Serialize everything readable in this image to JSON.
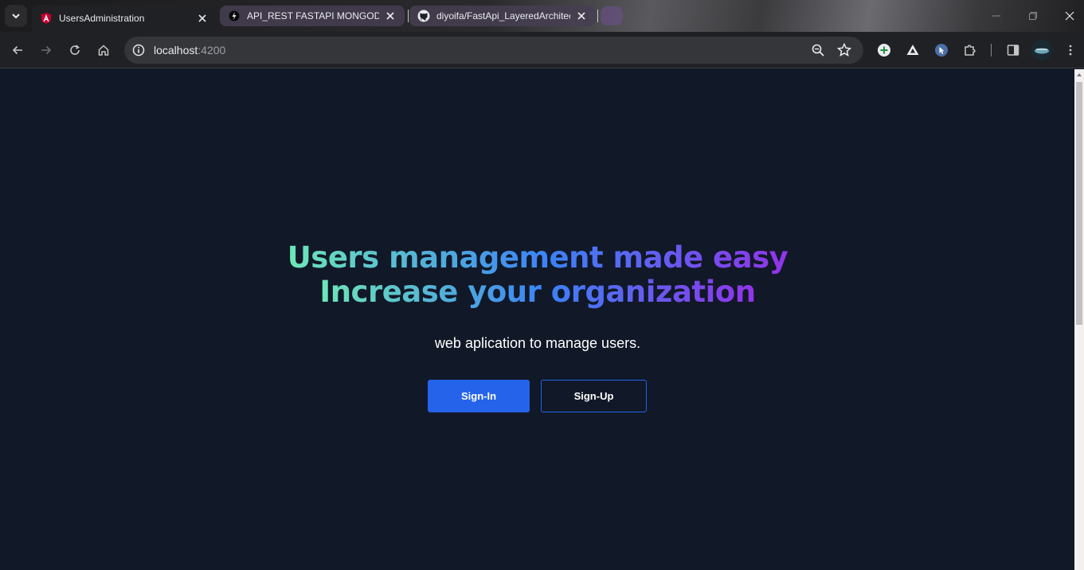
{
  "browser": {
    "tabs": [
      {
        "label": "UsersAdministration",
        "icon": "angular-icon",
        "active": true
      },
      {
        "label": "API_REST FASTAPI MONGODB J",
        "icon": "fastapi-icon",
        "active": false
      },
      {
        "label": "diyoifa/FastApi_LayeredArchitec",
        "icon": "github-icon",
        "active": false
      }
    ],
    "url_host": "localhost",
    "url_port": ":4200"
  },
  "hero": {
    "line1": "Users management made easy",
    "line2": "Increase your organization",
    "subtitle": "web aplication to manage users."
  },
  "actions": {
    "signin_label": "Sign-In",
    "signup_label": "Sign-Up"
  },
  "colors": {
    "page_bg": "#111827",
    "primary": "#2563eb",
    "gradient_start": "#6ee7b7",
    "gradient_mid": "#3b82f6",
    "gradient_end": "#9333ea"
  }
}
